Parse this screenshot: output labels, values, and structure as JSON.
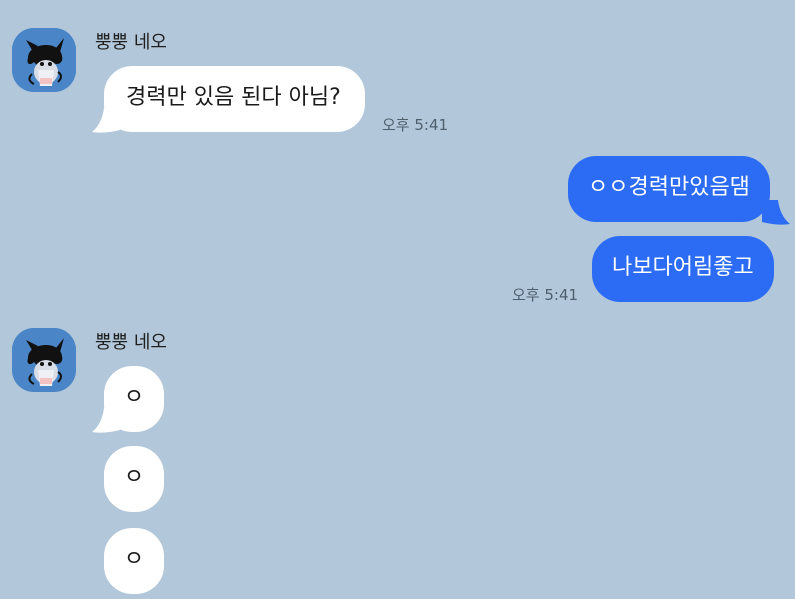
{
  "colors": {
    "background": "#b2c7d9",
    "incoming_bubble": "#ffffff",
    "outgoing_bubble": "#2c6cf4",
    "avatar_bg": "#4a86c7"
  },
  "messages": {
    "group1": {
      "sender": "뿡뿡 네오",
      "avatar_icon": "neo-character-avatar",
      "bubble1": "경력만 있음 된다 아님?",
      "time": "오후 5:41"
    },
    "outgoing": {
      "bubble1": "ㅇㅇ경력만있음댐",
      "bubble2": "나보다어림좋고",
      "time": "오후 5:41"
    },
    "group2": {
      "sender": "뿡뿡 네오",
      "avatar_icon": "neo-character-avatar",
      "bubble1": "ㅇ",
      "bubble2": "ㅇ",
      "bubble3": "ㅇ"
    }
  }
}
